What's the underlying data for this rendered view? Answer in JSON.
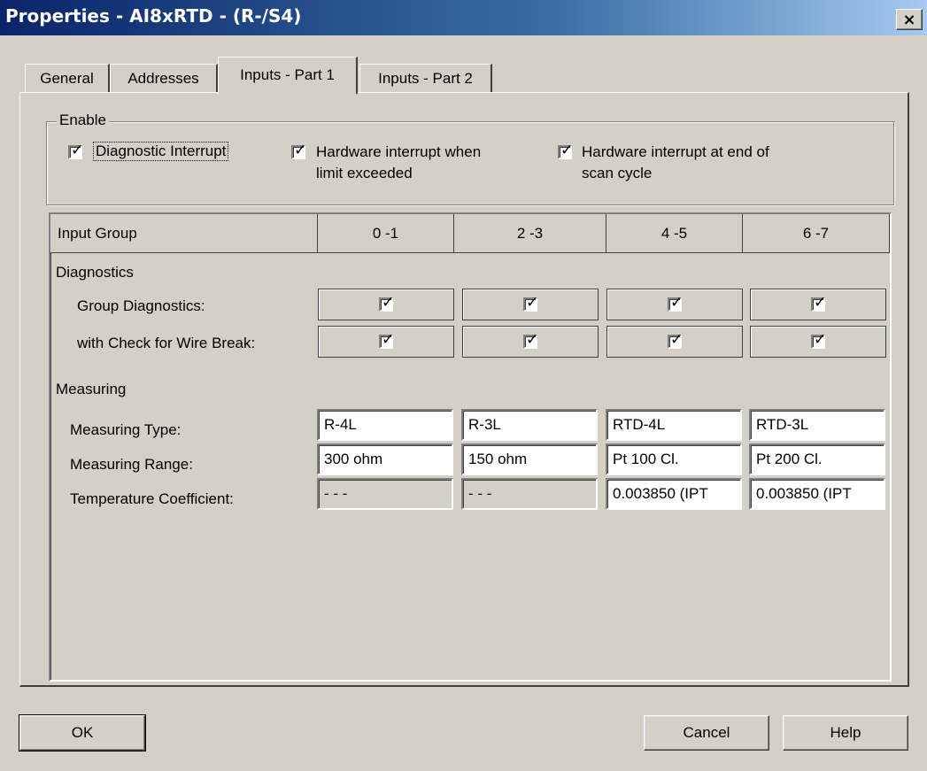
{
  "window": {
    "title": "Properties - AI8xRTD - (R-/S4)",
    "close_label": "×"
  },
  "tabs": [
    {
      "label": "General"
    },
    {
      "label": "Addresses"
    },
    {
      "label": "Inputs - Part 1"
    },
    {
      "label": "Inputs - Part 2"
    }
  ],
  "enable": {
    "legend": "Enable",
    "diag_interrupt": {
      "label": "Diagnostic Interrupt",
      "checked": true
    },
    "hw_limit": {
      "line1": "Hardware interrupt when",
      "line2": "limit exceeded",
      "checked": true
    },
    "hw_scan": {
      "line1": "Hardware interrupt at end of",
      "line2": "scan cycle",
      "checked": true
    }
  },
  "table": {
    "header_label": "Input Group",
    "groups": [
      "0 -1",
      "2 -3",
      "4 -5",
      "6 -7"
    ],
    "diagnostics_label": "Diagnostics",
    "group_diag_label": "Group Diagnostics:",
    "wire_break_label": "with Check for Wire Break:",
    "measuring_label": "Measuring",
    "measuring_type_label": "Measuring Type:",
    "measuring_range_label": "Measuring Range:",
    "temp_coef_label": "Temperature Coefficient:",
    "measuring_type": [
      "R-4L",
      "R-3L",
      "RTD-4L",
      "RTD-3L"
    ],
    "measuring_range": [
      "300 ohm",
      "150 ohm",
      "Pt 100 Cl.",
      "Pt 200 Cl."
    ],
    "temp_coef": [
      "- - -",
      "- - -",
      "0.003850 (IPT",
      "0.003850 (IPT"
    ]
  },
  "buttons": {
    "ok": "OK",
    "cancel": "Cancel",
    "help": "Help"
  }
}
